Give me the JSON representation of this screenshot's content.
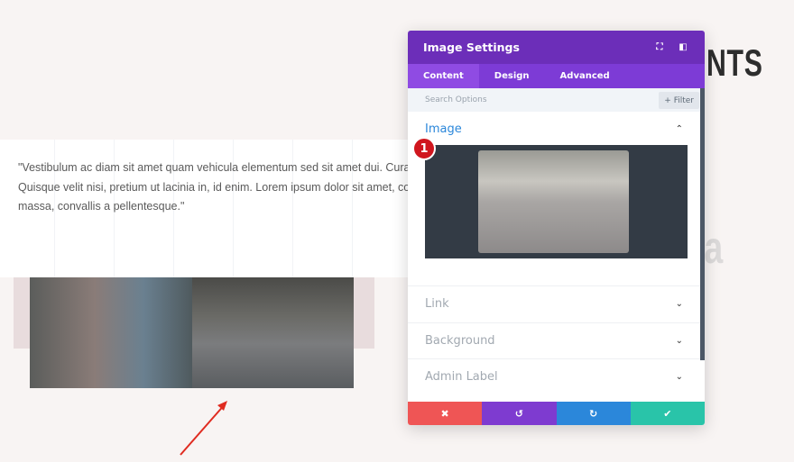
{
  "background_page": {
    "heading_fragment": "NTS",
    "faded_heading_fragment": "ia",
    "quote_lines": [
      "\"Vestibulum ac diam sit amet quam vehicula elementum sed sit amet dui. Curabit",
      "Quisque velit nisi, pretium ut lacinia in, id enim. Lorem ipsum dolor sit amet, cons",
      "massa, convallis a pellentesque.\""
    ]
  },
  "modal": {
    "title": "Image Settings",
    "header_icons": [
      "fullscreen-icon",
      "split-view-icon"
    ],
    "tabs": [
      {
        "label": "Content",
        "active": true
      },
      {
        "label": "Design",
        "active": false
      },
      {
        "label": "Advanced",
        "active": false
      }
    ],
    "search_placeholder": "Search Options",
    "filter_label": "+ Filter",
    "sections": [
      {
        "label": "Image",
        "open": true
      },
      {
        "label": "Link",
        "open": false
      },
      {
        "label": "Background",
        "open": false
      },
      {
        "label": "Admin Label",
        "open": false
      }
    ],
    "step_badge": "1",
    "footer_buttons": [
      {
        "name": "discard",
        "icon": "✖",
        "color": "#ef5555"
      },
      {
        "name": "undo",
        "icon": "↺",
        "color": "#7e3bd0"
      },
      {
        "name": "redo",
        "icon": "↻",
        "color": "#2b87da"
      },
      {
        "name": "save",
        "icon": "✔",
        "color": "#29c4a9"
      }
    ]
  },
  "colors": {
    "header": "#6c2eb9",
    "tabs": "#7d3bd6",
    "accent": "#2b87da",
    "arrow": "#e02b20"
  }
}
